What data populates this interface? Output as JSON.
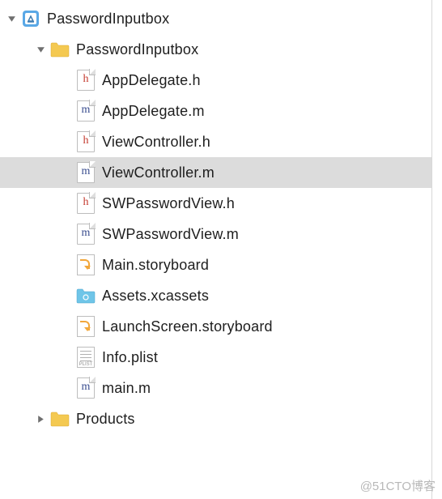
{
  "root": {
    "label": "PasswordInputbox",
    "expanded": true
  },
  "group": {
    "label": "PasswordInputbox",
    "expanded": true
  },
  "files": {
    "appdelegate_h": "AppDelegate.h",
    "appdelegate_m": "AppDelegate.m",
    "viewcontroller_h": "ViewController.h",
    "viewcontroller_m": "ViewController.m",
    "swpasswordview_h": "SWPasswordView.h",
    "swpasswordview_m": "SWPasswordView.m",
    "main_storyboard": "Main.storyboard",
    "assets": "Assets.xcassets",
    "launchscreen": "LaunchScreen.storyboard",
    "info_plist": "Info.plist",
    "main_m": "main.m"
  },
  "products": {
    "label": "Products",
    "expanded": false
  },
  "selected": "viewcontroller_m",
  "watermark": "@51CTO博客"
}
